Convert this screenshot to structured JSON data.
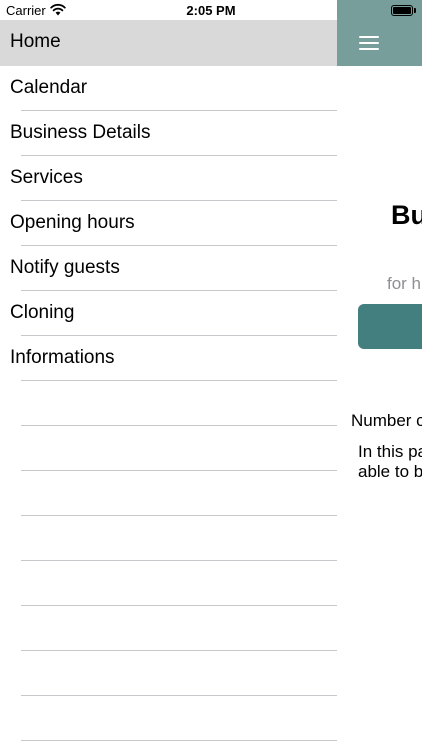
{
  "status_bar": {
    "carrier": "Carrier",
    "time": "2:05 PM"
  },
  "drawer": {
    "selected_color": "#d9d9d9",
    "items": [
      {
        "label": "Home",
        "selected": true
      },
      {
        "label": "Calendar"
      },
      {
        "label": "Business Details"
      },
      {
        "label": "Services"
      },
      {
        "label": "Opening hours"
      },
      {
        "label": "Notify guests"
      },
      {
        "label": "Cloning"
      },
      {
        "label": "Informations"
      }
    ]
  },
  "main": {
    "header_color": "#779e9b",
    "button_color": "#447f7f",
    "title": "Bu",
    "subtitle": "for h",
    "number_label": "Number c",
    "description_line1": "In this pa",
    "description_line2": "able to b"
  }
}
